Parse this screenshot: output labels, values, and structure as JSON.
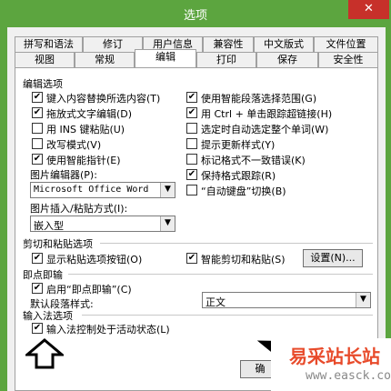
{
  "window": {
    "title": "选项",
    "close_glyph": "✕"
  },
  "tabs_row1": [
    "拼写和语法",
    "修订",
    "用户信息",
    "兼容性",
    "中文版式",
    "文件位置"
  ],
  "tabs_row2": [
    "视图",
    "常规",
    "编辑",
    "打印",
    "保存",
    "安全性"
  ],
  "active_tab": "编辑",
  "editing": {
    "section": "编辑选项",
    "left": [
      {
        "label": "键入内容替换所选内容(T)",
        "checked": true
      },
      {
        "label": "拖放式文字编辑(D)",
        "checked": true
      },
      {
        "label": "用 INS 键粘贴(U)",
        "checked": false
      },
      {
        "label": "改写模式(V)",
        "checked": false
      },
      {
        "label": "使用智能指针(E)",
        "checked": true
      }
    ],
    "right": [
      {
        "label": "使用智能段落选择范围(G)",
        "checked": true
      },
      {
        "label": "用 Ctrl + 单击跟踪超链接(H)",
        "checked": true
      },
      {
        "label": "选定时自动选定整个单词(W)",
        "checked": false
      },
      {
        "label": "提示更新样式(Y)",
        "checked": false
      },
      {
        "label": "标记格式不一致错误(K)",
        "checked": false
      },
      {
        "label": "保持格式跟踪(R)",
        "checked": true
      },
      {
        "label": "“自动键盘”切换(B)",
        "checked": false
      }
    ],
    "picture_editor_label": "图片编辑器(P):",
    "picture_editor_value": "Microsoft Office Word",
    "insert_label": "图片插入/粘贴方式(I):",
    "insert_value": "嵌入型"
  },
  "cut_paste": {
    "section": "剪切和粘贴选项",
    "show_paste_btn": {
      "label": "显示粘贴选项按钮(O)",
      "checked": true
    },
    "smart_cut": {
      "label": "智能剪切和粘贴(S)",
      "checked": true
    },
    "settings_btn": "设置(N)..."
  },
  "click_type": {
    "section": "即点即输",
    "enable": {
      "label": "启用“即点即输”(C)",
      "checked": true
    },
    "default_style_label": "默认段落样式:",
    "default_style_value": "正文"
  },
  "ime": {
    "section": "输入法选项",
    "ime_control": {
      "label": "输入法控制处于活动状态(L)",
      "checked": true
    }
  },
  "ok_button_partial": "确",
  "check_glyph": "✔",
  "dropdown_glyph": "▼",
  "watermark": {
    "brand": "易采站长站",
    "site": "www.easck.com"
  },
  "icons": {
    "close": "close-icon",
    "arrow": "up-arrow-annotation",
    "tri": "triangle-arrow-annotation"
  }
}
